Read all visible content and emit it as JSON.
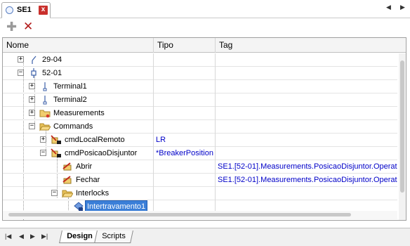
{
  "tab": {
    "title": "SE1",
    "close_glyph": "x",
    "left_arrow": "◀",
    "right_arrow": "▶"
  },
  "toolbar": {
    "add_glyph": "✚",
    "delete_glyph": "✕"
  },
  "columns": {
    "nome": "Nome",
    "tipo": "Tipo",
    "tag": "Tag"
  },
  "rows": [
    {
      "label": "29-04",
      "tipo": "",
      "tag": "",
      "expander": "+",
      "icon": "switch-icon"
    },
    {
      "label": "52-01",
      "tipo": "",
      "tag": "",
      "expander": "−",
      "icon": "breaker-icon"
    },
    {
      "label": "Terminal1",
      "tipo": "",
      "tag": "",
      "expander": "+",
      "icon": "terminal-icon"
    },
    {
      "label": "Terminal2",
      "tipo": "",
      "tag": "",
      "expander": "+",
      "icon": "terminal-icon"
    },
    {
      "label": "Measurements",
      "tipo": "",
      "tag": "",
      "expander": "+",
      "icon": "folder-icon"
    },
    {
      "label": "Commands",
      "tipo": "",
      "tag": "",
      "expander": "−",
      "icon": "folder-open-icon"
    },
    {
      "label": "cmdLocalRemoto",
      "tipo": "LR",
      "tag": "",
      "expander": "+",
      "icon": "command-icon"
    },
    {
      "label": "cmdPosicaoDisjuntor",
      "tipo": "*BreakerPosition",
      "tag": "",
      "expander": "−",
      "icon": "command-icon"
    },
    {
      "label": "Abrir",
      "tipo": "",
      "tag": "SE1.[52-01].Measurements.PosicaoDisjuntor.Operat",
      "expander": "",
      "icon": "action-icon"
    },
    {
      "label": "Fechar",
      "tipo": "",
      "tag": "SE1.[52-01].Measurements.PosicaoDisjuntor.Operat",
      "expander": "",
      "icon": "action-icon"
    },
    {
      "label": "Interlocks",
      "tipo": "",
      "tag": "",
      "expander": "−",
      "icon": "folder-open-icon"
    },
    {
      "label": "Intertravamento1",
      "tipo": "",
      "tag": "",
      "expander": "",
      "icon": "interlock-icon",
      "selected": true
    }
  ],
  "bottom_tabs": {
    "design": "Design",
    "scripts": "Scripts"
  },
  "bottom_nav": {
    "first": "|◀",
    "prev": "◀",
    "next": "▶",
    "last": "▶|"
  }
}
